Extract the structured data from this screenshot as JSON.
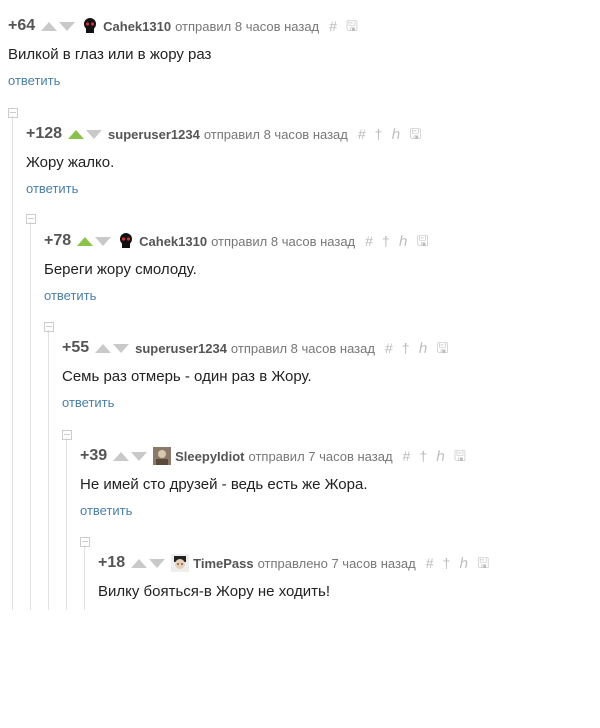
{
  "comments": [
    {
      "rating": "+64",
      "up_active": false,
      "username": "Cahek1310",
      "action": "отправил 8 часов назад",
      "text": "Вилкой в глаз или в жору раз",
      "reply": "ответить",
      "avatar": "skull-avatar"
    },
    {
      "rating": "+128",
      "up_active": true,
      "username": "superuser1234",
      "action": "отправил 8 часов назад",
      "text": "Жору жалко.",
      "reply": "ответить",
      "avatar": ""
    },
    {
      "rating": "+78",
      "up_active": true,
      "username": "Cahek1310",
      "action": "отправил 8 часов назад",
      "text": "Береги жору смолоду.",
      "reply": "ответить",
      "avatar": "skull-avatar"
    },
    {
      "rating": "+55",
      "up_active": false,
      "username": "superuser1234",
      "action": "отправил 8 часов назад",
      "text": "Семь раз отмерь - один раз в Жору.",
      "reply": "ответить",
      "avatar": ""
    },
    {
      "rating": "+39",
      "up_active": false,
      "username": "SleepyIdiot",
      "action": "отправил 7 часов назад",
      "text": "Не имей сто друзей - ведь есть же Жора.",
      "reply": "ответить",
      "avatar": "photo-avatar"
    },
    {
      "rating": "+18",
      "up_active": false,
      "username": "TimePass",
      "action": "отправлено 7 часов назад",
      "text": "Вилку бояться-в Жору не ходить!",
      "reply": "",
      "avatar": "face-avatar"
    }
  ],
  "icons": {
    "link": "hash-icon",
    "save": "save-icon",
    "parent": "arrow-up-icon",
    "branch": "branch-icon"
  },
  "colors": {
    "upvote_active": "#8bc34a",
    "vote_inactive": "#c9c9c9",
    "reply_link": "#4a7fa8"
  }
}
